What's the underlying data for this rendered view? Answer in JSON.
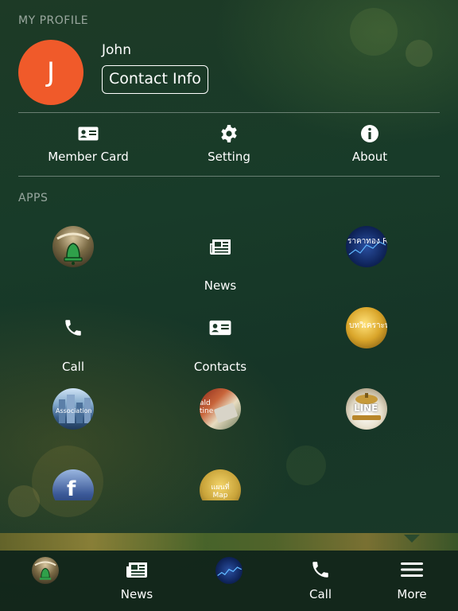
{
  "profile": {
    "section_title": "MY PROFILE",
    "avatar_initial": "J",
    "name": "John",
    "contact_button": "Contact Info"
  },
  "quick_actions": [
    {
      "label": "Member Card",
      "icon": "id-card-icon"
    },
    {
      "label": "Setting",
      "icon": "gear-icon"
    },
    {
      "label": "About",
      "icon": "info-icon"
    }
  ],
  "apps": {
    "section_title": "APPS",
    "items": [
      {
        "label": "",
        "icon": "bell-app-icon"
      },
      {
        "label": "News",
        "icon": "newspaper-icon"
      },
      {
        "label": "",
        "icon": "realtime-spot-app-icon",
        "text": "ราคาทอง Realtime Spot"
      },
      {
        "label": "Call",
        "icon": "phone-icon"
      },
      {
        "label": "Contacts",
        "icon": "contact-card-icon"
      },
      {
        "label": "",
        "icon": "gold-analysis-app-icon",
        "text": "บทวิเคราะห์ Analysis"
      },
      {
        "label": "",
        "icon": "city-app-icon",
        "text": "Association"
      },
      {
        "label": "",
        "icon": "online-trading-app-icon",
        "text": "ald tine"
      },
      {
        "label": "",
        "icon": "line-app-icon",
        "text": "LINE"
      },
      {
        "label": "",
        "icon": "facebook-app-icon",
        "text": "f"
      },
      {
        "label": "",
        "icon": "map-app-icon",
        "text": "แผนที่ Map"
      }
    ]
  },
  "tab_bar": [
    {
      "label": "",
      "icon": "bell-app-icon"
    },
    {
      "label": "News",
      "icon": "newspaper-icon"
    },
    {
      "label": "",
      "icon": "realtime-spot-app-icon"
    },
    {
      "label": "Call",
      "icon": "phone-icon"
    },
    {
      "label": "More",
      "icon": "menu-icon"
    }
  ],
  "colors": {
    "avatar": "#f05a2a",
    "background": "#183b29"
  }
}
